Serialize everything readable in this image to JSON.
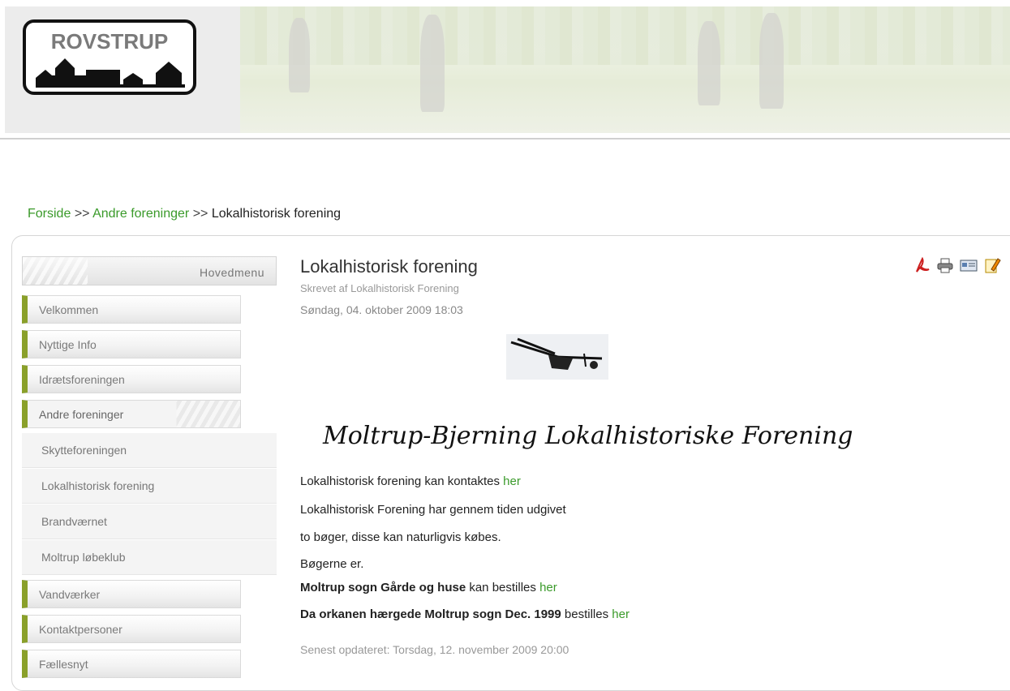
{
  "logo": {
    "text": "ROVSTRUP"
  },
  "breadcrumb": {
    "items": [
      "Forside",
      "Andre foreninger"
    ],
    "separator": ">>",
    "current": "Lokalhistorisk forening"
  },
  "menu": {
    "header": "Hovedmenu",
    "items_top": [
      {
        "label": "Velkommen"
      },
      {
        "label": "Nyttige Info"
      },
      {
        "label": "Idrætsforeningen"
      },
      {
        "label": "Andre foreninger"
      }
    ],
    "subitems": [
      {
        "label": "Skytteforeningen"
      },
      {
        "label": "Lokalhistorisk forening"
      },
      {
        "label": "Brandværnet"
      },
      {
        "label": "Moltrup løbeklub"
      }
    ],
    "items_bottom": [
      {
        "label": "Vandværker"
      },
      {
        "label": "Kontaktpersoner"
      },
      {
        "label": "Fællesnyt"
      }
    ]
  },
  "article": {
    "title": "Lokalhistorisk forening",
    "author": "Skrevet af Lokalhistorisk Forening",
    "date": "Søndag, 04. oktober 2009 18:03",
    "calligraphy": "Moltrup-Bjerning Lokalhistoriske Forening",
    "line1_text": "Lokalhistorisk forening kan kontaktes ",
    "line1_link": "her",
    "line2": "Lokalhistorisk Forening har gennem tiden udgivet",
    "line3": "to bøger, disse kan naturligvis købes.",
    "line4": "Bøgerne er.",
    "book1_bold": "Moltrup sogn Gårde og huse",
    "book1_text": " kan bestilles ",
    "book1_link": "her",
    "book2_bold": "Da orkanen hærgede Moltrup sogn Dec. 1999",
    "book2_text": " bestilles ",
    "book2_link": "her",
    "updated": "Senest opdateret: Torsdag, 12. november 2009 20:00"
  },
  "icons": [
    "pdf-icon",
    "print-icon",
    "email-icon",
    "edit-icon"
  ],
  "colors": {
    "link": "#3a9a2a",
    "menu_accent": "#8aa02a"
  }
}
